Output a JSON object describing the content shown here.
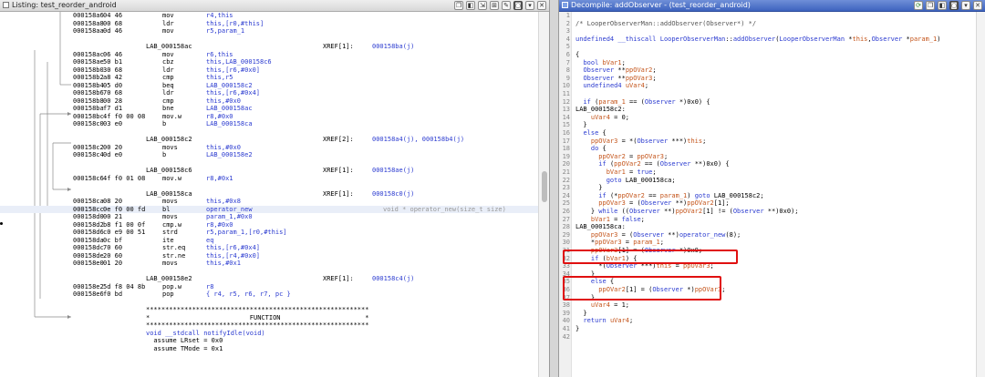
{
  "listing": {
    "title": "Listing:  test_reorder_android",
    "rows": [
      {
        "addr": "000158a6",
        "bytes": "04 46",
        "mnem": "mov",
        "ops": "r4,this"
      },
      {
        "addr": "000158a8",
        "bytes": "00 68",
        "mnem": "ldr",
        "ops": "this,[r0,#this]"
      },
      {
        "addr": "000158aa",
        "bytes": "0d 46",
        "mnem": "mov",
        "ops": "r5,param_1"
      },
      {
        "blank": true
      },
      {
        "label": "LAB_000158ac",
        "xref": "XREF[1]:",
        "xrefv": "000158ba(j)"
      },
      {
        "addr": "000158ac",
        "bytes": "06 46",
        "mnem": "mov",
        "ops": "r6,this"
      },
      {
        "addr": "000158ae",
        "bytes": "50 b1",
        "mnem": "cbz",
        "ops": "this,LAB_000158c6"
      },
      {
        "addr": "000158b0",
        "bytes": "30 68",
        "mnem": "ldr",
        "ops": "this,[r6,#0x0]"
      },
      {
        "addr": "000158b2",
        "bytes": "a8 42",
        "mnem": "cmp",
        "ops": "this,r5"
      },
      {
        "addr": "000158b4",
        "bytes": "05 d0",
        "mnem": "beq",
        "ops": "LAB_000158c2"
      },
      {
        "addr": "000158b6",
        "bytes": "70 68",
        "mnem": "ldr",
        "ops": "this,[r6,#0x4]"
      },
      {
        "addr": "000158b8",
        "bytes": "00 28",
        "mnem": "cmp",
        "ops": "this,#0x0"
      },
      {
        "addr": "000158ba",
        "bytes": "f7 d1",
        "mnem": "bne",
        "ops": "LAB_000158ac"
      },
      {
        "addr": "000158bc",
        "bytes": "4f f0 00 08",
        "mnem": "mov.w",
        "ops": "r8,#0x0"
      },
      {
        "addr": "000158c0",
        "bytes": "03 e0",
        "mnem": "b",
        "ops": "LAB_000158ca"
      },
      {
        "blank": true
      },
      {
        "label": "LAB_000158c2",
        "xref": "XREF[2]:",
        "xrefv": "000158a4(j), 000158b4(j)"
      },
      {
        "addr": "000158c2",
        "bytes": "00 20",
        "mnem": "movs",
        "ops": "this,#0x0"
      },
      {
        "addr": "000158c4",
        "bytes": "0d e0",
        "mnem": "b",
        "ops": "LAB_000158e2"
      },
      {
        "blank": true
      },
      {
        "label": "LAB_000158c6",
        "xref": "XREF[1]:",
        "xrefv": "000158ae(j)"
      },
      {
        "addr": "000158c6",
        "bytes": "4f f0 01 08",
        "mnem": "mov.w",
        "ops": "r8,#0x1"
      },
      {
        "blank": true
      },
      {
        "label": "LAB_000158ca",
        "xref": "XREF[1]:",
        "xrefv": "000158c0(j)"
      },
      {
        "addr": "000158ca",
        "bytes": "08 20",
        "mnem": "movs",
        "ops": "this,#0x8"
      },
      {
        "addr": "000158cc",
        "bytes": "0e f0 00 fd",
        "mnem": "bl",
        "ops": "operator_new",
        "cmt": "void * operator_new(size_t size)",
        "hl": true
      },
      {
        "addr": "000158d0",
        "bytes": "00 21",
        "mnem": "movs",
        "ops": "param_1,#0x0"
      },
      {
        "addr": "000158d2",
        "bytes": "b8 f1 00 0f",
        "mnem": "cmp.w",
        "ops": "r8,#0x0"
      },
      {
        "addr": "000158d6",
        "bytes": "c0 e9 00 51",
        "mnem": "strd",
        "ops": "r5,param_1,[r0,#this]"
      },
      {
        "addr": "000158da",
        "bytes": "0c bf",
        "mnem": "ite",
        "ops": "eq"
      },
      {
        "addr": "000158dc",
        "bytes": "70 60",
        "mnem": "str.eq",
        "ops": "this,[r6,#0x4]"
      },
      {
        "addr": "000158de",
        "bytes": "20 60",
        "mnem": "str.ne",
        "ops": "this,[r4,#0x0]"
      },
      {
        "addr": "000158e0",
        "bytes": "01 20",
        "mnem": "movs",
        "ops": "this,#0x1"
      },
      {
        "blank": true
      },
      {
        "label": "LAB_000158e2",
        "xref": "XREF[1]:",
        "xrefv": "000158c4(j)"
      },
      {
        "addr": "000158e2",
        "bytes": "5d f8 04 8b",
        "mnem": "pop.w",
        "ops": "r8"
      },
      {
        "addr": "000158e6",
        "bytes": "f0 bd",
        "mnem": "pop",
        "ops": "{ r4, r5, r6, r7, pc }"
      },
      {
        "blank": true
      },
      {
        "func": "**********************************************************"
      },
      {
        "func": "*                          FUNCTION                      *"
      },
      {
        "func": "**********************************************************"
      },
      {
        "func": "void __stdcall notifyIdle(void)",
        "blue": true
      },
      {
        "func": "  assume LRset = 0x0"
      },
      {
        "func": "  assume TMode = 0x1"
      }
    ]
  },
  "decompile": {
    "title": "Decompile: addObserver -  (test_reorder_android)",
    "lines": [
      "",
      "/* LooperObserverMan::addObserver(Observer*) */",
      "",
      "undefined4 __thiscall LooperObserverMan::addObserver(LooperObserverMan *this,Observer *param_1)",
      "",
      "{",
      "  bool bVar1;",
      "  Observer **ppOVar2;",
      "  Observer **ppOVar3;",
      "  undefined4 uVar4;",
      "",
      "  if (param_1 == (Observer *)0x0) {",
      "LAB_000158c2:",
      "    uVar4 = 0;",
      "  }",
      "  else {",
      "    ppOVar3 = *(Observer ***)this;",
      "    do {",
      "      ppOVar2 = ppOVar3;",
      "      if (ppOVar2 == (Observer **)0x0) {",
      "        bVar1 = true;",
      "        goto LAB_000158ca;",
      "      }",
      "      if (*ppOVar2 == param_1) goto LAB_000158c2;",
      "      ppOVar3 = (Observer **)ppOVar2[1];",
      "    } while ((Observer **)ppOVar2[1] != (Observer **)0x0);",
      "    bVar1 = false;",
      "LAB_000158ca:",
      "    ppOVar3 = (Observer **)operator_new(8);",
      "    *ppOVar3 = param_1;",
      "    ppOVar3[1] = (Observer *)0x0;",
      "    if (bVar1) {",
      "      *(Observer ***)this = ppOVar3;",
      "    }",
      "    else {",
      "      ppOVar2[1] = (Observer *)ppOVar3;",
      "    }",
      "    uVar4 = 1;",
      "  }",
      "  return uVar4;",
      "}",
      ""
    ]
  },
  "icons": [
    "listing-icon",
    "decompile-icon",
    "refresh-icon",
    "copy-icon",
    "snapshot-icon",
    "export-icon",
    "camera-icon",
    "menu-icon",
    "close-icon"
  ],
  "colors": {
    "highlight_box": "#e01010",
    "keyword": "#2b3bd0",
    "variable": "#c4541a",
    "decomp_title": "#3e63be"
  }
}
